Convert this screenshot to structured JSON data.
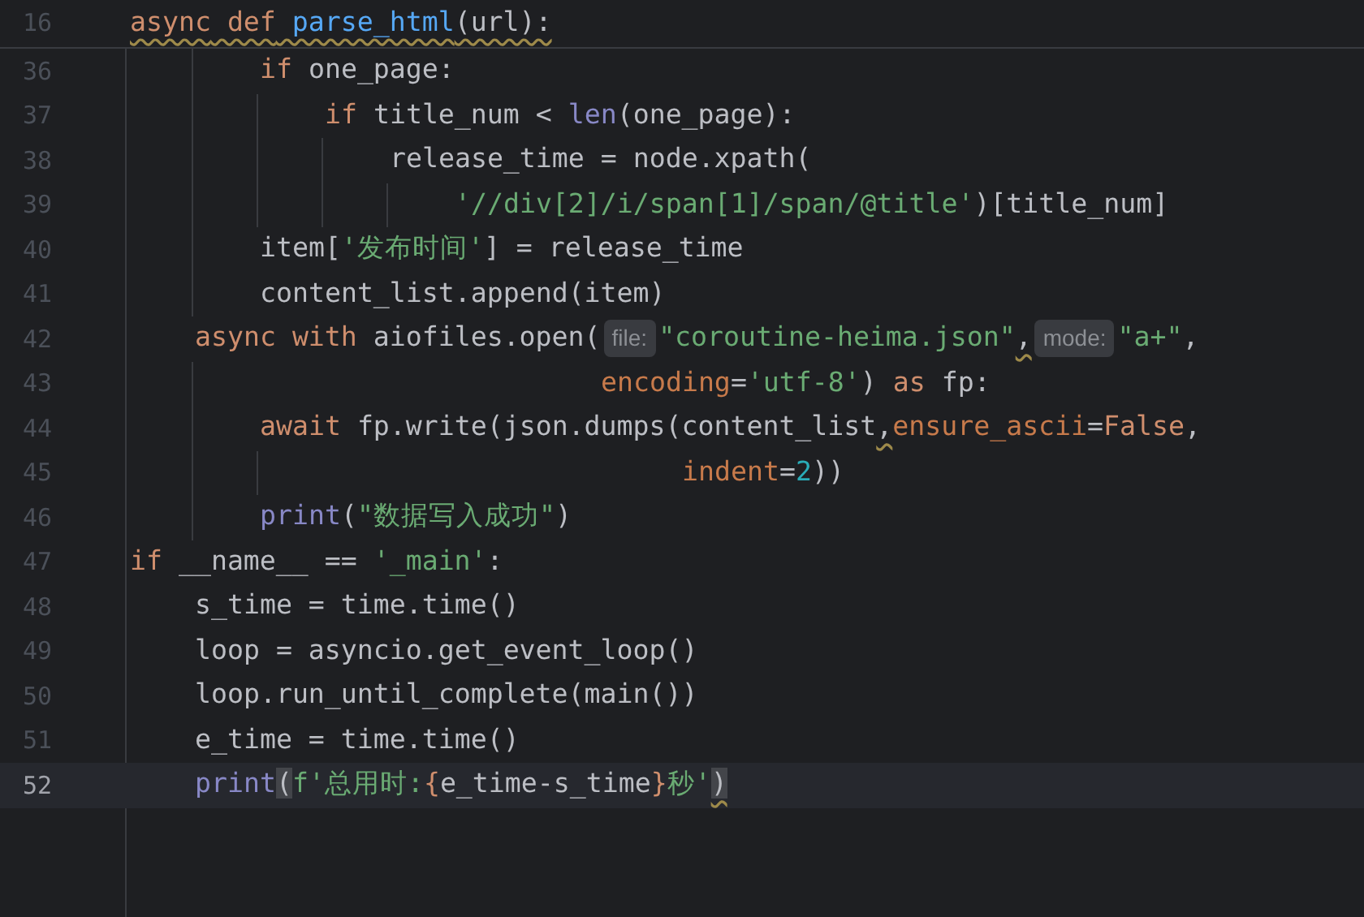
{
  "sticky_header": {
    "number": "16",
    "tokens": [
      {
        "text": "async",
        "kind": "kw",
        "warning": true
      },
      {
        "text": " def",
        "kind": "kw",
        "warning": true
      },
      {
        "text": " parse_html",
        "kind": "fn",
        "warning": true
      },
      {
        "text": "(url):",
        "kind": "id",
        "warning": true
      }
    ]
  },
  "lines": [
    {
      "number": "36",
      "current": false,
      "tokens": [
        {
          "text": "        if",
          "kind": "kw"
        },
        {
          "text": " one_page:",
          "kind": "id"
        }
      ]
    },
    {
      "number": "37",
      "current": false,
      "tokens": [
        {
          "text": "            if",
          "kind": "kw"
        },
        {
          "text": " title_num < ",
          "kind": "id"
        },
        {
          "text": "len",
          "kind": "builtin"
        },
        {
          "text": "(one_page):",
          "kind": "id"
        }
      ]
    },
    {
      "number": "38",
      "current": false,
      "tokens": [
        {
          "text": "                release_time = node.xpath(",
          "kind": "id"
        }
      ]
    },
    {
      "number": "39",
      "current": false,
      "tokens": [
        {
          "text": "                    '//div[2]/i/span[1]/span/@title'",
          "kind": "str"
        },
        {
          "text": ")[title_num]",
          "kind": "id"
        }
      ]
    },
    {
      "number": "40",
      "current": false,
      "tokens": [
        {
          "text": "        item[",
          "kind": "id"
        },
        {
          "text": "'发布时间'",
          "kind": "str"
        },
        {
          "text": "] = release_time",
          "kind": "id"
        }
      ]
    },
    {
      "number": "41",
      "current": false,
      "tokens": [
        {
          "text": "        content_list.append(item)",
          "kind": "id"
        }
      ]
    },
    {
      "number": "42",
      "current": false,
      "tokens": [
        {
          "text": "    async",
          "kind": "kw"
        },
        {
          "text": " with",
          "kind": "kw"
        },
        {
          "text": " aiofiles.open(",
          "kind": "id"
        },
        {
          "text": "file:",
          "kind": "hint"
        },
        {
          "text": "\"coroutine-heima.json\"",
          "kind": "str"
        },
        {
          "text": ",",
          "kind": "id",
          "warning": true
        },
        {
          "text": "mode:",
          "kind": "hint"
        },
        {
          "text": "\"a+\"",
          "kind": "str"
        },
        {
          "text": ",",
          "kind": "id"
        }
      ]
    },
    {
      "number": "43",
      "current": false,
      "tokens": [
        {
          "text": "                             encoding",
          "kind": "param"
        },
        {
          "text": "=",
          "kind": "id"
        },
        {
          "text": "'utf-8'",
          "kind": "str"
        },
        {
          "text": ") ",
          "kind": "id"
        },
        {
          "text": "as",
          "kind": "kw"
        },
        {
          "text": " fp:",
          "kind": "id"
        }
      ]
    },
    {
      "number": "44",
      "current": false,
      "tokens": [
        {
          "text": "        await",
          "kind": "kw"
        },
        {
          "text": " fp.write(json.dumps(content_list",
          "kind": "id"
        },
        {
          "text": ",",
          "kind": "id",
          "warning": true
        },
        {
          "text": "ensure_ascii",
          "kind": "param"
        },
        {
          "text": "=",
          "kind": "id"
        },
        {
          "text": "False",
          "kind": "kw"
        },
        {
          "text": ",",
          "kind": "id"
        }
      ]
    },
    {
      "number": "45",
      "current": false,
      "tokens": [
        {
          "text": "                                  indent",
          "kind": "param"
        },
        {
          "text": "=",
          "kind": "id"
        },
        {
          "text": "2",
          "kind": "num"
        },
        {
          "text": "))",
          "kind": "id"
        }
      ]
    },
    {
      "number": "46",
      "current": false,
      "tokens": [
        {
          "text": "        print",
          "kind": "builtin"
        },
        {
          "text": "(",
          "kind": "id"
        },
        {
          "text": "\"数据写入成功\"",
          "kind": "str"
        },
        {
          "text": ")",
          "kind": "id"
        }
      ]
    },
    {
      "number": "47",
      "current": false,
      "tokens": [
        {
          "text": "if",
          "kind": "kw"
        },
        {
          "text": " __name__ == ",
          "kind": "id"
        },
        {
          "text": "'_main'",
          "kind": "str"
        },
        {
          "text": ":",
          "kind": "id"
        }
      ]
    },
    {
      "number": "48",
      "current": false,
      "tokens": [
        {
          "text": "    s_time = time.time()",
          "kind": "id"
        }
      ]
    },
    {
      "number": "49",
      "current": false,
      "tokens": [
        {
          "text": "    loop = asyncio.get_event_loop()",
          "kind": "id"
        }
      ]
    },
    {
      "number": "50",
      "current": false,
      "tokens": [
        {
          "text": "    loop.run_until_complete(main())",
          "kind": "id"
        }
      ]
    },
    {
      "number": "51",
      "current": false,
      "tokens": [
        {
          "text": "    e_time = time.time()",
          "kind": "id"
        }
      ]
    },
    {
      "number": "52",
      "current": true,
      "tokens": [
        {
          "text": "    print",
          "kind": "builtin"
        },
        {
          "text": "(",
          "kind": "id",
          "matched": true
        },
        {
          "text": "f'总用时:",
          "kind": "str"
        },
        {
          "text": "{",
          "kind": "kw"
        },
        {
          "text": "e_time-s_time",
          "kind": "id"
        },
        {
          "text": "}",
          "kind": "kw"
        },
        {
          "text": "秒'",
          "kind": "str"
        },
        {
          "text": ")",
          "kind": "id",
          "matched": true,
          "warning": true
        }
      ]
    }
  ]
}
